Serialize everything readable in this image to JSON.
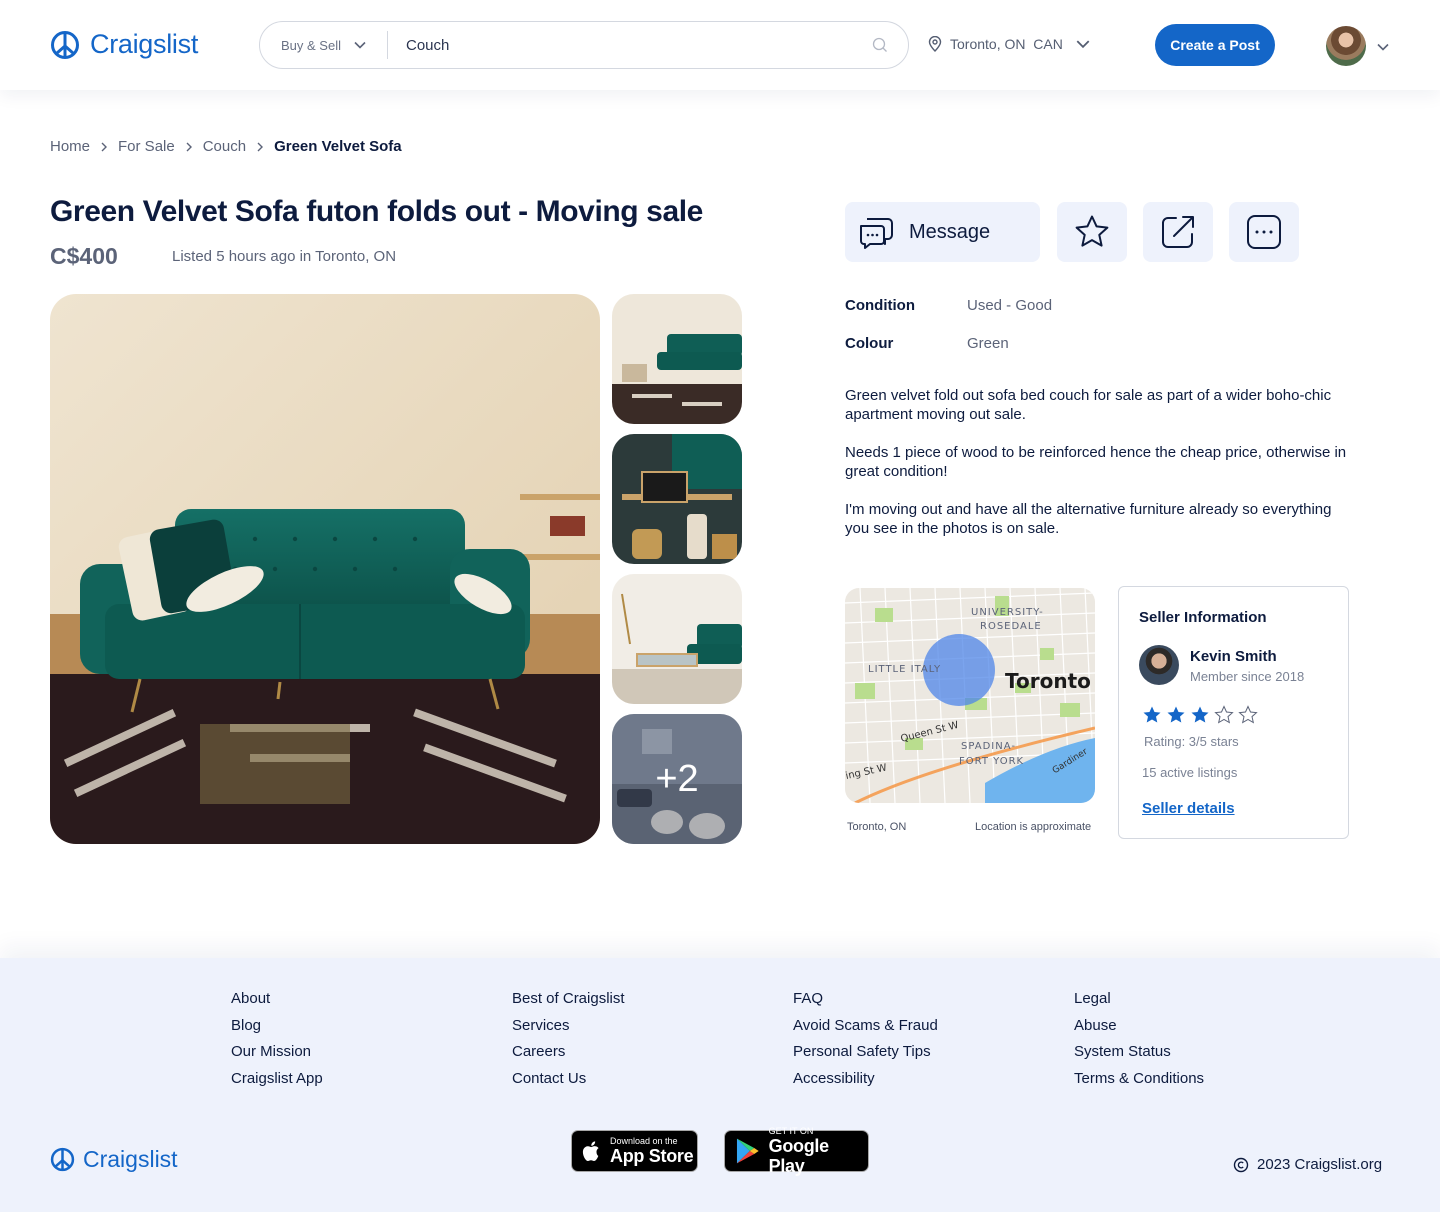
{
  "header": {
    "logo_text": "Craigslist",
    "category": "Buy & Sell",
    "search_value": "Couch",
    "location": "Toronto, ON  CAN",
    "create_post_label": "Create a Post"
  },
  "breadcrumb": [
    "Home",
    "For Sale",
    "Couch",
    "Green Velvet Sofa"
  ],
  "listing": {
    "title": "Green Velvet Sofa futon folds out - Moving sale",
    "price": "C$400",
    "listed": "Listed 5 hours ago in Toronto, ON",
    "more_photos": "+2"
  },
  "actions": {
    "message_label": "Message"
  },
  "details": [
    {
      "label": "Condition",
      "value": "Used - Good"
    },
    {
      "label": "Colour",
      "value": "Green"
    }
  ],
  "description": [
    "Green velvet fold out sofa bed couch for sale as part of a wider boho-chic apartment moving out sale.",
    "Needs 1 piece of wood to be reinforced hence the cheap price, otherwise in great condition!",
    "I'm moving out and have all the alternative furniture already so everything you see in the photos is on sale."
  ],
  "map": {
    "labels": [
      "UNIVERSITY-",
      "ROSEDALE",
      "LITTLE ITALY",
      "Toronto",
      "Queen St W",
      "SPADINA-",
      "FORT YORK",
      "Gardiner",
      "ing St W"
    ],
    "caption_left": "Toronto, ON",
    "caption_right": "Location is approximate"
  },
  "seller": {
    "heading": "Seller Information",
    "name": "Kevin Smith",
    "since": "Member since 2018",
    "rating_value": 3,
    "rating_max": 5,
    "rating_text": "Rating: 3/5 stars",
    "listings": "15 active listings",
    "details_link": "Seller details"
  },
  "footer": {
    "columns": [
      [
        "About",
        "Blog",
        "Our Mission",
        "Craigslist App"
      ],
      [
        "Best of Craigslist",
        "Services",
        "Careers",
        "Contact Us"
      ],
      [
        "FAQ",
        "Avoid Scams & Fraud",
        "Personal Safety Tips",
        "Accessibility"
      ],
      [
        "Legal",
        "Abuse",
        "System Status",
        "Terms & Conditions"
      ]
    ],
    "logo_text": "Craigslist",
    "app_store_small": "Download on the",
    "app_store_big": "App Store",
    "google_small": "GET IT ON",
    "google_big": "Google Play",
    "copyright": "2023 Craigslist.org"
  },
  "colors": {
    "brand": "#1466c8",
    "text": "#0d1b3e",
    "muted": "#5b6378",
    "tint": "#eef2fc",
    "velvet": "#0f5e55"
  },
  "icons": [
    "peace-logo-icon",
    "chevron-down-icon",
    "search-icon",
    "location-pin-icon",
    "chat-bubbles-icon",
    "star-icon",
    "share-icon",
    "more-options-icon",
    "copyright-icon",
    "apple-icon",
    "google-play-icon"
  ]
}
